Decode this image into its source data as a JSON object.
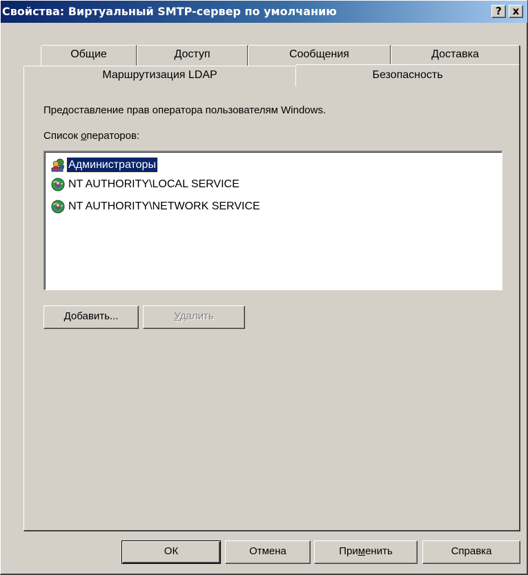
{
  "window": {
    "title": "Свойства: Виртуальный SMTP-сервер по умолчанию",
    "help_glyph": "?",
    "close_glyph": "x"
  },
  "tabs_row1": [
    {
      "label": "Общие"
    },
    {
      "label": "Доступ"
    },
    {
      "label": "Сообщения"
    },
    {
      "label": "Доставка"
    }
  ],
  "tabs_row2": [
    {
      "label": "Маршрутизация LDAP"
    },
    {
      "label": "Безопасность",
      "selected": true
    }
  ],
  "security": {
    "description": "Предоставление прав оператора пользователям Windows.",
    "list_label_prefix": "Список ",
    "list_label_accel": "о",
    "list_label_rest": "ператоров:",
    "operators": [
      {
        "label": "Администраторы",
        "icon": "users-group-icon",
        "selected": true
      },
      {
        "label": "NT AUTHORITY\\LOCAL SERVICE",
        "icon": "globe-user-icon"
      },
      {
        "label": "NT AUTHORITY\\NETWORK SERVICE",
        "icon": "globe-user-icon"
      }
    ],
    "add_accel": "Д",
    "add_rest": "обавить...",
    "remove_accel": "У",
    "remove_rest": "далить"
  },
  "footer": {
    "ok": "ОК",
    "cancel": "Отмена",
    "apply_prefix": "При",
    "apply_accel": "м",
    "apply_rest": "енить",
    "help": "Справка"
  },
  "colors": {
    "face": "#d4d0c8",
    "selection": "#0a246a",
    "title_start": "#0a246a",
    "title_end": "#a6caf0"
  }
}
